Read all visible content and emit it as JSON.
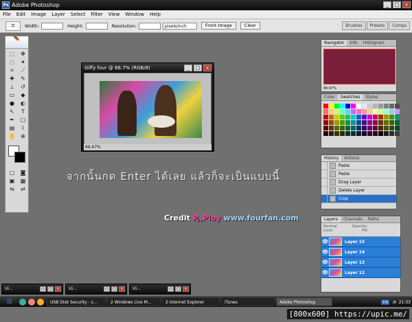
{
  "app": {
    "title": "Adobe Photoshop"
  },
  "menu": [
    "File",
    "Edit",
    "Image",
    "Layer",
    "Select",
    "Filter",
    "View",
    "Window",
    "Help"
  ],
  "options": {
    "width_label": "Width:",
    "height_label": "Height:",
    "resolution_label": "Resolution:",
    "unit_value": "pixels/inch",
    "front_image": "Front Image",
    "clear": "Clear"
  },
  "wells": [
    "Brushes",
    "Presets",
    "Comps"
  ],
  "document": {
    "title": "Giffy four @ 66.7% (RGB/8)",
    "zoom": "66.67%"
  },
  "overlay": {
    "thai_text": "จากนั้นกด Enter ได้เลย แล้วก็จะเป็นแบบนี้",
    "credit_label": "Credit",
    "credit_author": "P,,Ploy",
    "credit_site": "www.fourfan.com"
  },
  "navigator": {
    "tabs": [
      "Navigator",
      "Info",
      "Histogram"
    ],
    "zoom": "66.67%"
  },
  "swatches": {
    "tabs": [
      "Color",
      "Swatches",
      "Styles"
    ],
    "colors": [
      "#ff0000",
      "#ffff00",
      "#00ff00",
      "#00ffff",
      "#0000ff",
      "#ff00ff",
      "#ffffff",
      "#e6e6e6",
      "#cccccc",
      "#b3b3b3",
      "#999999",
      "#808080",
      "#666666",
      "#4d4d4d",
      "#ff6666",
      "#ffcc66",
      "#ccff66",
      "#66ffcc",
      "#66ccff",
      "#cc66ff",
      "#ff66cc",
      "#ff9999",
      "#ffcc99",
      "#ffff99",
      "#ccff99",
      "#99ffcc",
      "#99ccff",
      "#cc99ff",
      "#cc0000",
      "#cc6600",
      "#cccc00",
      "#66cc00",
      "#00cc66",
      "#00cccc",
      "#0066cc",
      "#6600cc",
      "#cc00cc",
      "#cc0066",
      "#993300",
      "#999900",
      "#339900",
      "#009966",
      "#990000",
      "#994c00",
      "#999900",
      "#4c9900",
      "#00994c",
      "#009999",
      "#004c99",
      "#4c0099",
      "#990099",
      "#99004c",
      "#663300",
      "#666600",
      "#336600",
      "#006633",
      "#660000",
      "#663300",
      "#666600",
      "#336600",
      "#006633",
      "#006666",
      "#003366",
      "#330066",
      "#660066",
      "#660033",
      "#4d2600",
      "#4d4d00",
      "#264d00",
      "#004d26",
      "#330000",
      "#331a00",
      "#333300",
      "#1a3300",
      "#00331a",
      "#003333",
      "#001a33",
      "#1a0033",
      "#330033",
      "#33001a",
      "#000000",
      "#1a1a1a",
      "#2b2b2b",
      "#3d3d3d"
    ]
  },
  "history": {
    "tabs": [
      "History",
      "Actions"
    ],
    "items": [
      "Paste",
      "Paste",
      "Drag Layer",
      "Delete Layer",
      "Crop"
    ]
  },
  "layers": {
    "tabs": [
      "Layers",
      "Channels",
      "Paths"
    ],
    "mode": "Normal",
    "opacity": "Opacity:",
    "lock": "Lock:",
    "fill": "Fill:",
    "items": [
      "Layer 15",
      "Layer 14",
      "Layer 13",
      "Layer 12"
    ]
  },
  "minimized": [
    "Ui...",
    "Ui...",
    "Ui..."
  ],
  "taskbar": {
    "tasks": [
      "USB Disk Security - z...",
      "2 Windows Live M...",
      "2 Internet Explorer",
      "iTunes",
      "Adobe Photoshop"
    ],
    "lang": "EN",
    "time": "21:33"
  },
  "watermark": "[800x600] https://upic.me/"
}
